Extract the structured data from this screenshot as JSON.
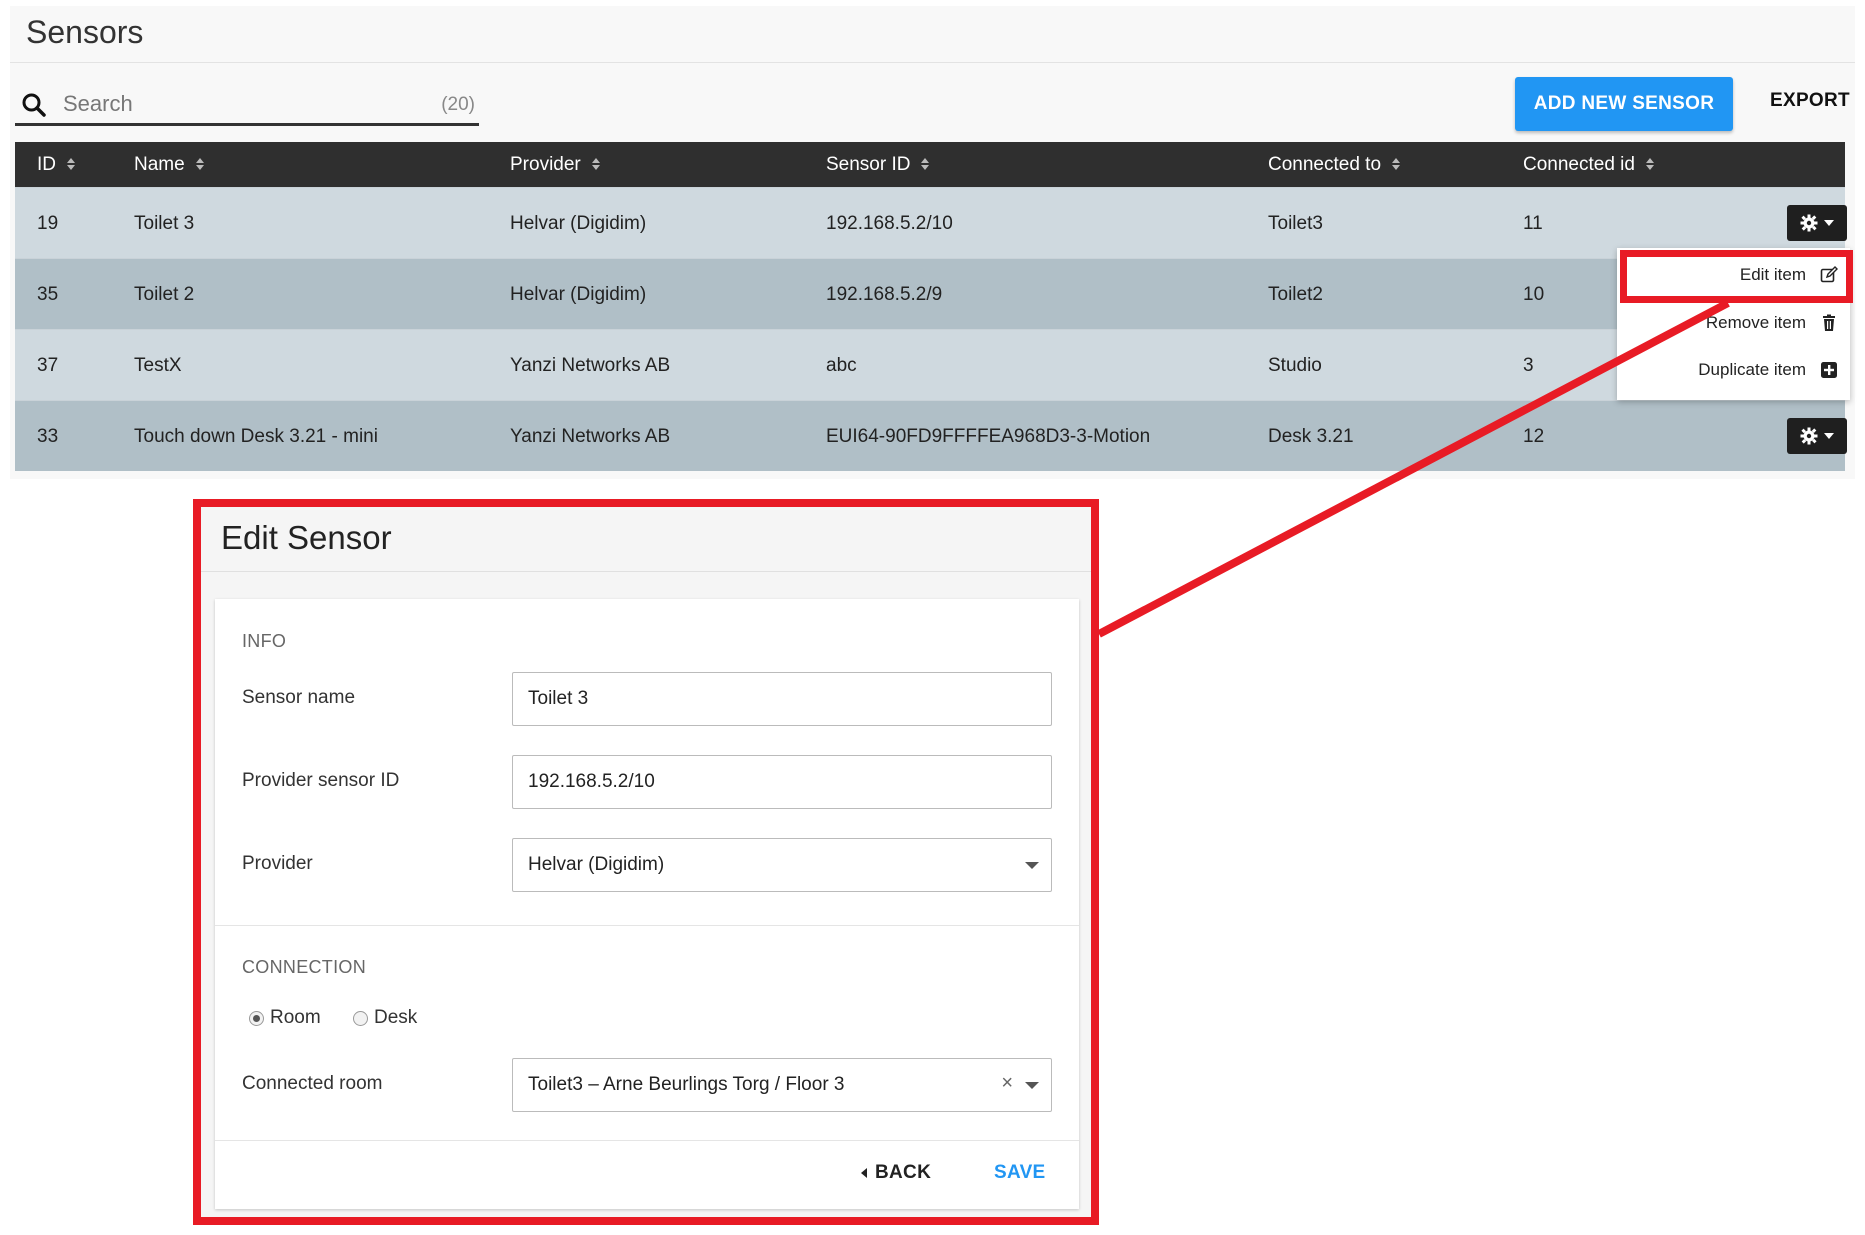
{
  "page": {
    "title": "Sensors"
  },
  "toolbar": {
    "search_placeholder": "Search",
    "result_count": "(20)",
    "add_label": "ADD NEW SENSOR",
    "export_label": "EXPORT"
  },
  "table": {
    "columns": [
      "ID",
      "Name",
      "Provider",
      "Sensor ID",
      "Connected to",
      "Connected id"
    ],
    "rows": [
      {
        "id": "19",
        "name": "Toilet 3",
        "provider": "Helvar (Digidim)",
        "sensor_id": "192.168.5.2/10",
        "connected_to": "Toilet3",
        "connected_id": "11"
      },
      {
        "id": "35",
        "name": "Toilet 2",
        "provider": "Helvar (Digidim)",
        "sensor_id": "192.168.5.2/9",
        "connected_to": "Toilet2",
        "connected_id": "10"
      },
      {
        "id": "37",
        "name": "TestX",
        "provider": "Yanzi Networks AB",
        "sensor_id": "abc",
        "connected_to": "Studio",
        "connected_id": "3"
      },
      {
        "id": "33",
        "name": "Touch down Desk 3.21 - mini",
        "provider": "Yanzi Networks AB",
        "sensor_id": "EUI64-90FD9FFFFEA968D3-3-Motion",
        "connected_to": "Desk 3.21",
        "connected_id": "12"
      }
    ]
  },
  "row_menu": {
    "edit": "Edit item",
    "remove": "Remove item",
    "duplicate": "Duplicate item"
  },
  "modal": {
    "title": "Edit Sensor",
    "info_section": "INFO",
    "sensor_name_label": "Sensor name",
    "sensor_name_value": "Toilet 3",
    "provider_sensor_id_label": "Provider sensor ID",
    "provider_sensor_id_value": "192.168.5.2/10",
    "provider_label": "Provider",
    "provider_value": "Helvar (Digidim)",
    "connection_section": "CONNECTION",
    "radio_room": "Room",
    "radio_desk": "Desk",
    "connection_type_selected": "Room",
    "connected_room_label": "Connected room",
    "connected_room_value": "Toilet3 – Arne Beurlings Torg / Floor 3",
    "clear_symbol": "×",
    "back_label": "BACK",
    "save_label": "SAVE"
  },
  "colors": {
    "accent_blue": "#2196f3",
    "header_dark": "#2f2f2f",
    "row_light": "#cfd9df",
    "row_dark": "#b0bfc7",
    "annotation_red": "#e81b25"
  },
  "icons": {
    "search": "search-icon",
    "sort": "sort-icon",
    "gear": "gear-icon",
    "edit": "edit-icon",
    "trash": "trash-icon",
    "plus_square": "plus-square-icon",
    "back": "chevron-left-icon"
  }
}
